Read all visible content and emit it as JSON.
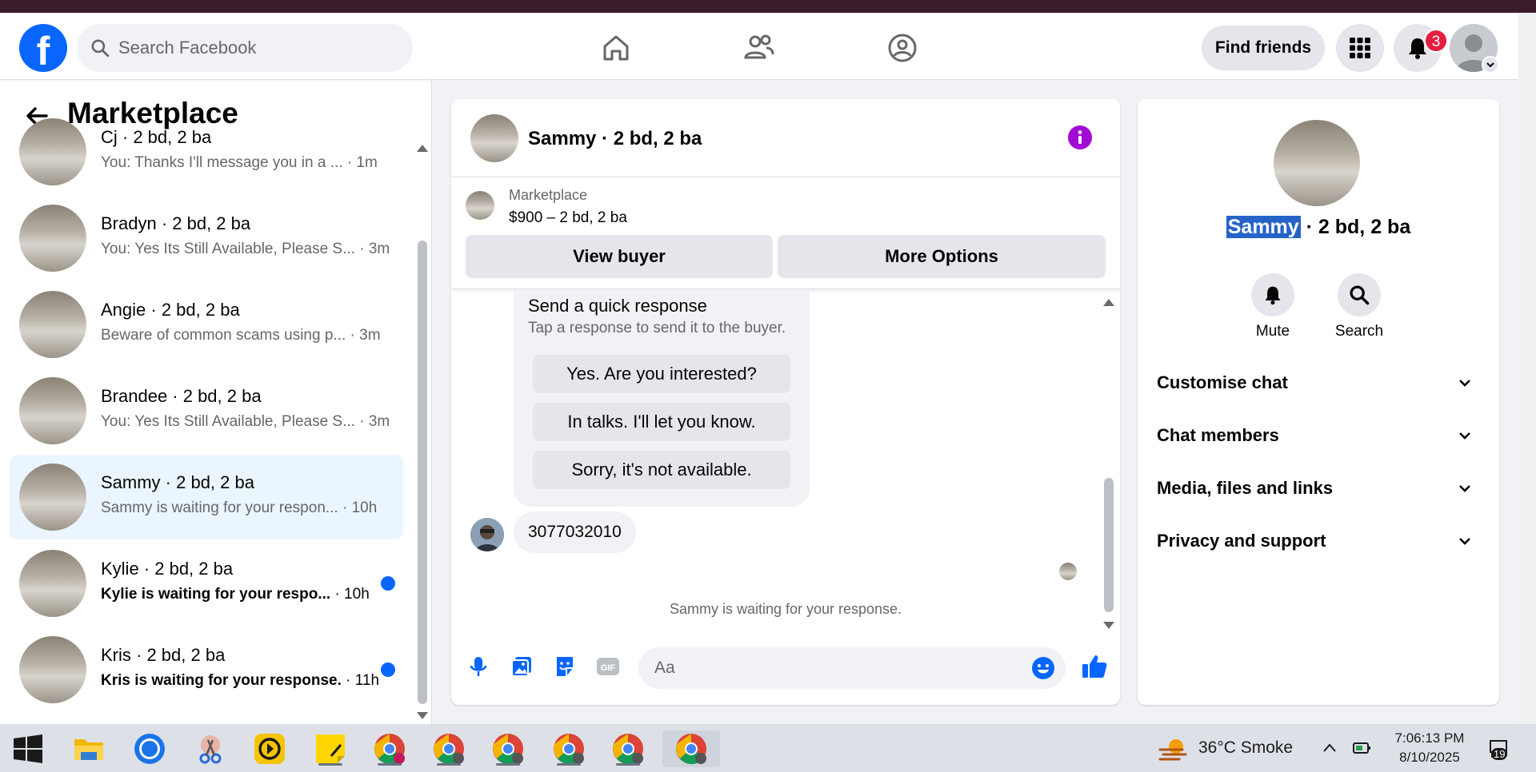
{
  "header": {
    "search_placeholder": "Search Facebook",
    "find_friends_label": "Find friends",
    "notification_count": "3",
    "logo_letter": "f"
  },
  "sidebar": {
    "title": "Marketplace",
    "conversations": [
      {
        "name": "Cj · 2 bd, 2 ba",
        "preview": "You: Thanks I'll message you in a ...",
        "time": " · 1m",
        "unread": false,
        "active": false
      },
      {
        "name": "Bradyn · 2 bd, 2 ba",
        "preview": "You: Yes Its Still Available, Please S...",
        "time": " · 3m",
        "unread": false,
        "active": false
      },
      {
        "name": "Angie · 2 bd, 2 ba",
        "preview": "Beware of common scams using p...",
        "time": " · 3m",
        "unread": false,
        "active": false
      },
      {
        "name": "Brandee · 2 bd, 2 ba",
        "preview": "You: Yes Its Still Available, Please S...",
        "time": " · 3m",
        "unread": false,
        "active": false
      },
      {
        "name": "Sammy · 2 bd, 2 ba",
        "preview": "Sammy is waiting for your respon...",
        "time": " · 10h",
        "unread": false,
        "active": true
      },
      {
        "name": "Kylie · 2 bd, 2 ba",
        "preview": "Kylie is waiting for your respo...",
        "time": " · 10h",
        "unread": true,
        "active": false
      },
      {
        "name": "Kris · 2 bd, 2 ba",
        "preview": "Kris is waiting for your response.",
        "time": " · 11h",
        "unread": true,
        "active": false
      }
    ]
  },
  "chat": {
    "title": "Sammy · 2 bd, 2 ba",
    "marketplace_label": "Marketplace",
    "listing": "$900 – 2 bd, 2 ba",
    "view_buyer_label": "View buyer",
    "more_options_label": "More Options",
    "quick_response_title": "Send a quick response",
    "quick_response_sub": "Tap a response to send it to the buyer.",
    "quick_responses": [
      "Yes. Are you interested?",
      "In talks. I'll let you know.",
      "Sorry, it's not available."
    ],
    "message": "3077032010",
    "waiting_text": "Sammy is waiting for your response.",
    "composer_placeholder": "Aa"
  },
  "details": {
    "name_highlight": "Sammy",
    "name_rest": " · 2 bd, 2 ba",
    "mute_label": "Mute",
    "search_label": "Search",
    "sections": [
      "Customise chat",
      "Chat members",
      "Media, files and links",
      "Privacy and support"
    ]
  },
  "taskbar": {
    "weather": "36°C  Smoke",
    "time": "7:06:13 PM",
    "date": "8/10/2025",
    "notif_count": "19"
  },
  "colors": {
    "brand": "#0866ff",
    "badge": "#e41e3f",
    "info": "#a20bd6"
  }
}
